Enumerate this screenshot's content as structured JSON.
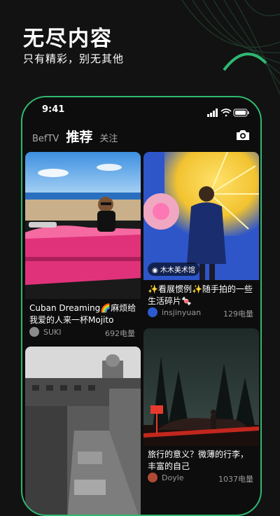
{
  "promo": {
    "headline": "无尽内容",
    "subheadline": "只有精彩，别无其他"
  },
  "status_bar": {
    "time": "9:41"
  },
  "tabs": [
    {
      "label": "BefTV"
    },
    {
      "label": "推荐"
    },
    {
      "label": "关注"
    }
  ],
  "feed": [
    {
      "caption": "Cuban Dreaming🌈麻烦给我爱的人来一杯Mojito",
      "user": "SUKI",
      "likes": "692电量"
    },
    {
      "caption": "✨看展惯例✨随手拍的一些生活碎片🍬",
      "location": "木木美术馆",
      "user": "insjinyuan",
      "likes": "129电量"
    },
    {
      "caption": "",
      "user": "",
      "likes": ""
    },
    {
      "caption": "旅行的意义？微薄的行李，丰富的自己",
      "user": "Doyle",
      "likes": "1037电量"
    }
  ],
  "colors": {
    "accent": "#2fb870",
    "background": "#121212"
  },
  "icons": [
    "camera-icon",
    "signal-icon",
    "wifi-icon",
    "battery-icon",
    "location-pin-icon"
  ]
}
